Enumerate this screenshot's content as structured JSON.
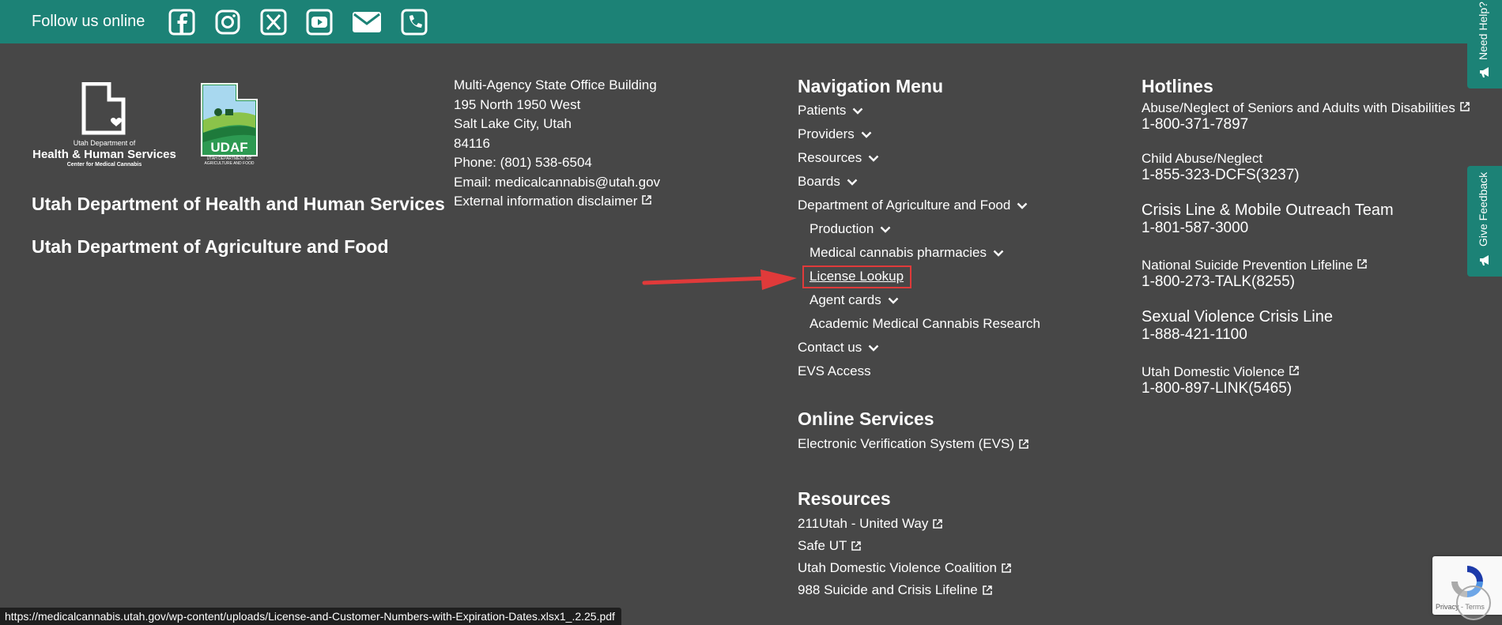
{
  "topbar": {
    "follow_label": "Follow us online",
    "social_icons": [
      "facebook-icon",
      "instagram-icon",
      "x-twitter-icon",
      "youtube-icon",
      "email-icon",
      "phone-icon"
    ]
  },
  "logos": {
    "dhhs": {
      "line1": "Utah Department of",
      "line2": "Health & Human Services",
      "line3": "Center for Medical Cannabis"
    },
    "udaf": {
      "name": "UDAF",
      "caption1": "UTAH DEPARTMENT OF",
      "caption2": "AGRICULTURE AND FOOD"
    }
  },
  "orgs": [
    "Utah Department of Health and Human Services",
    "Utah Department of Agriculture and Food"
  ],
  "address": {
    "line1": "Multi-Agency State Office Building",
    "line2": "195 North 1950 West",
    "line3": "Salt Lake City, Utah",
    "line4": "84116",
    "phone": "Phone: (801) 538-6504",
    "email": "Email: medicalcannabis@utah.gov",
    "disclaimer": "External information disclaimer"
  },
  "nav": {
    "title": "Navigation Menu",
    "items": [
      {
        "label": "Patients"
      },
      {
        "label": "Providers"
      },
      {
        "label": "Resources"
      },
      {
        "label": "Boards"
      },
      {
        "label": "Department of Agriculture and Food"
      },
      {
        "label": "Production"
      },
      {
        "label": "Medical cannabis pharmacies"
      },
      {
        "label": "License Lookup"
      },
      {
        "label": "Agent cards"
      },
      {
        "label": "Academic Medical Cannabis Research"
      },
      {
        "label": "Contact us"
      },
      {
        "label": "EVS Access"
      }
    ]
  },
  "online_services": {
    "title": "Online Services",
    "links": [
      "Electronic Verification System (EVS)"
    ]
  },
  "resources": {
    "title": "Resources",
    "links": [
      "211Utah - United Way",
      "Safe UT",
      "Utah Domestic Violence Coalition",
      "988 Suicide and Crisis Lifeline"
    ]
  },
  "hotlines": {
    "title": "Hotlines",
    "items": [
      {
        "label": "Abuse/Neglect of Seniors and Adults with Disabilities",
        "number": "1-800-371-7897"
      },
      {
        "label": "Child Abuse/Neglect",
        "number": "1-855-323-DCFS(3237)"
      },
      {
        "label": "Crisis Line & Mobile Outreach Team",
        "number": "1-801-587-3000"
      },
      {
        "label": "National Suicide Prevention Lifeline",
        "number": "1-800-273-TALK(8255)"
      },
      {
        "label": "Sexual Violence Crisis Line",
        "number": "1-888-421-1100"
      },
      {
        "label": "Utah Domestic Violence",
        "number": "1-800-897-LINK(5465)"
      }
    ]
  },
  "side_tabs": {
    "help": "Need Help?",
    "feedback": "Give Feedback"
  },
  "recaptcha": {
    "text": "Privacy - Terms"
  },
  "status_url": "https://medicalcannabis.utah.gov/wp-content/uploads/License-and-Customer-Numbers-with-Expiration-Dates.xlsx1_.2.25.pdf",
  "colors": {
    "teal": "#1c8276",
    "background": "#474747",
    "highlight": "#e03a3a"
  }
}
